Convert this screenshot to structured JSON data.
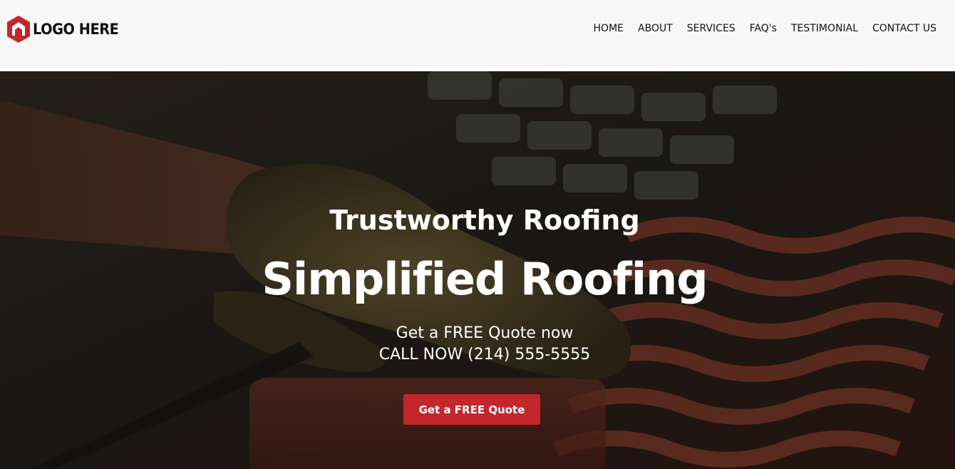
{
  "brand": {
    "logo_text": "LOGO HERE",
    "logo_icon": "house-hexagon-icon",
    "accent_color": "#c3262c"
  },
  "nav": {
    "items": [
      {
        "label": "HOME"
      },
      {
        "label": "ABOUT"
      },
      {
        "label": "SERVICES"
      },
      {
        "label": "FAQ's"
      },
      {
        "label": "TESTIMONIAL"
      },
      {
        "label": "CONTACT US"
      }
    ]
  },
  "hero": {
    "eyebrow": "Trustworthy Roofing",
    "headline": "Simplified Roofing",
    "subline_1": "Get a FREE Quote now",
    "subline_2": "CALL NOW (214) 555-5555",
    "cta_label": "Get a FREE Quote",
    "background_image": "hands-laying-roof-tiles-photo"
  }
}
